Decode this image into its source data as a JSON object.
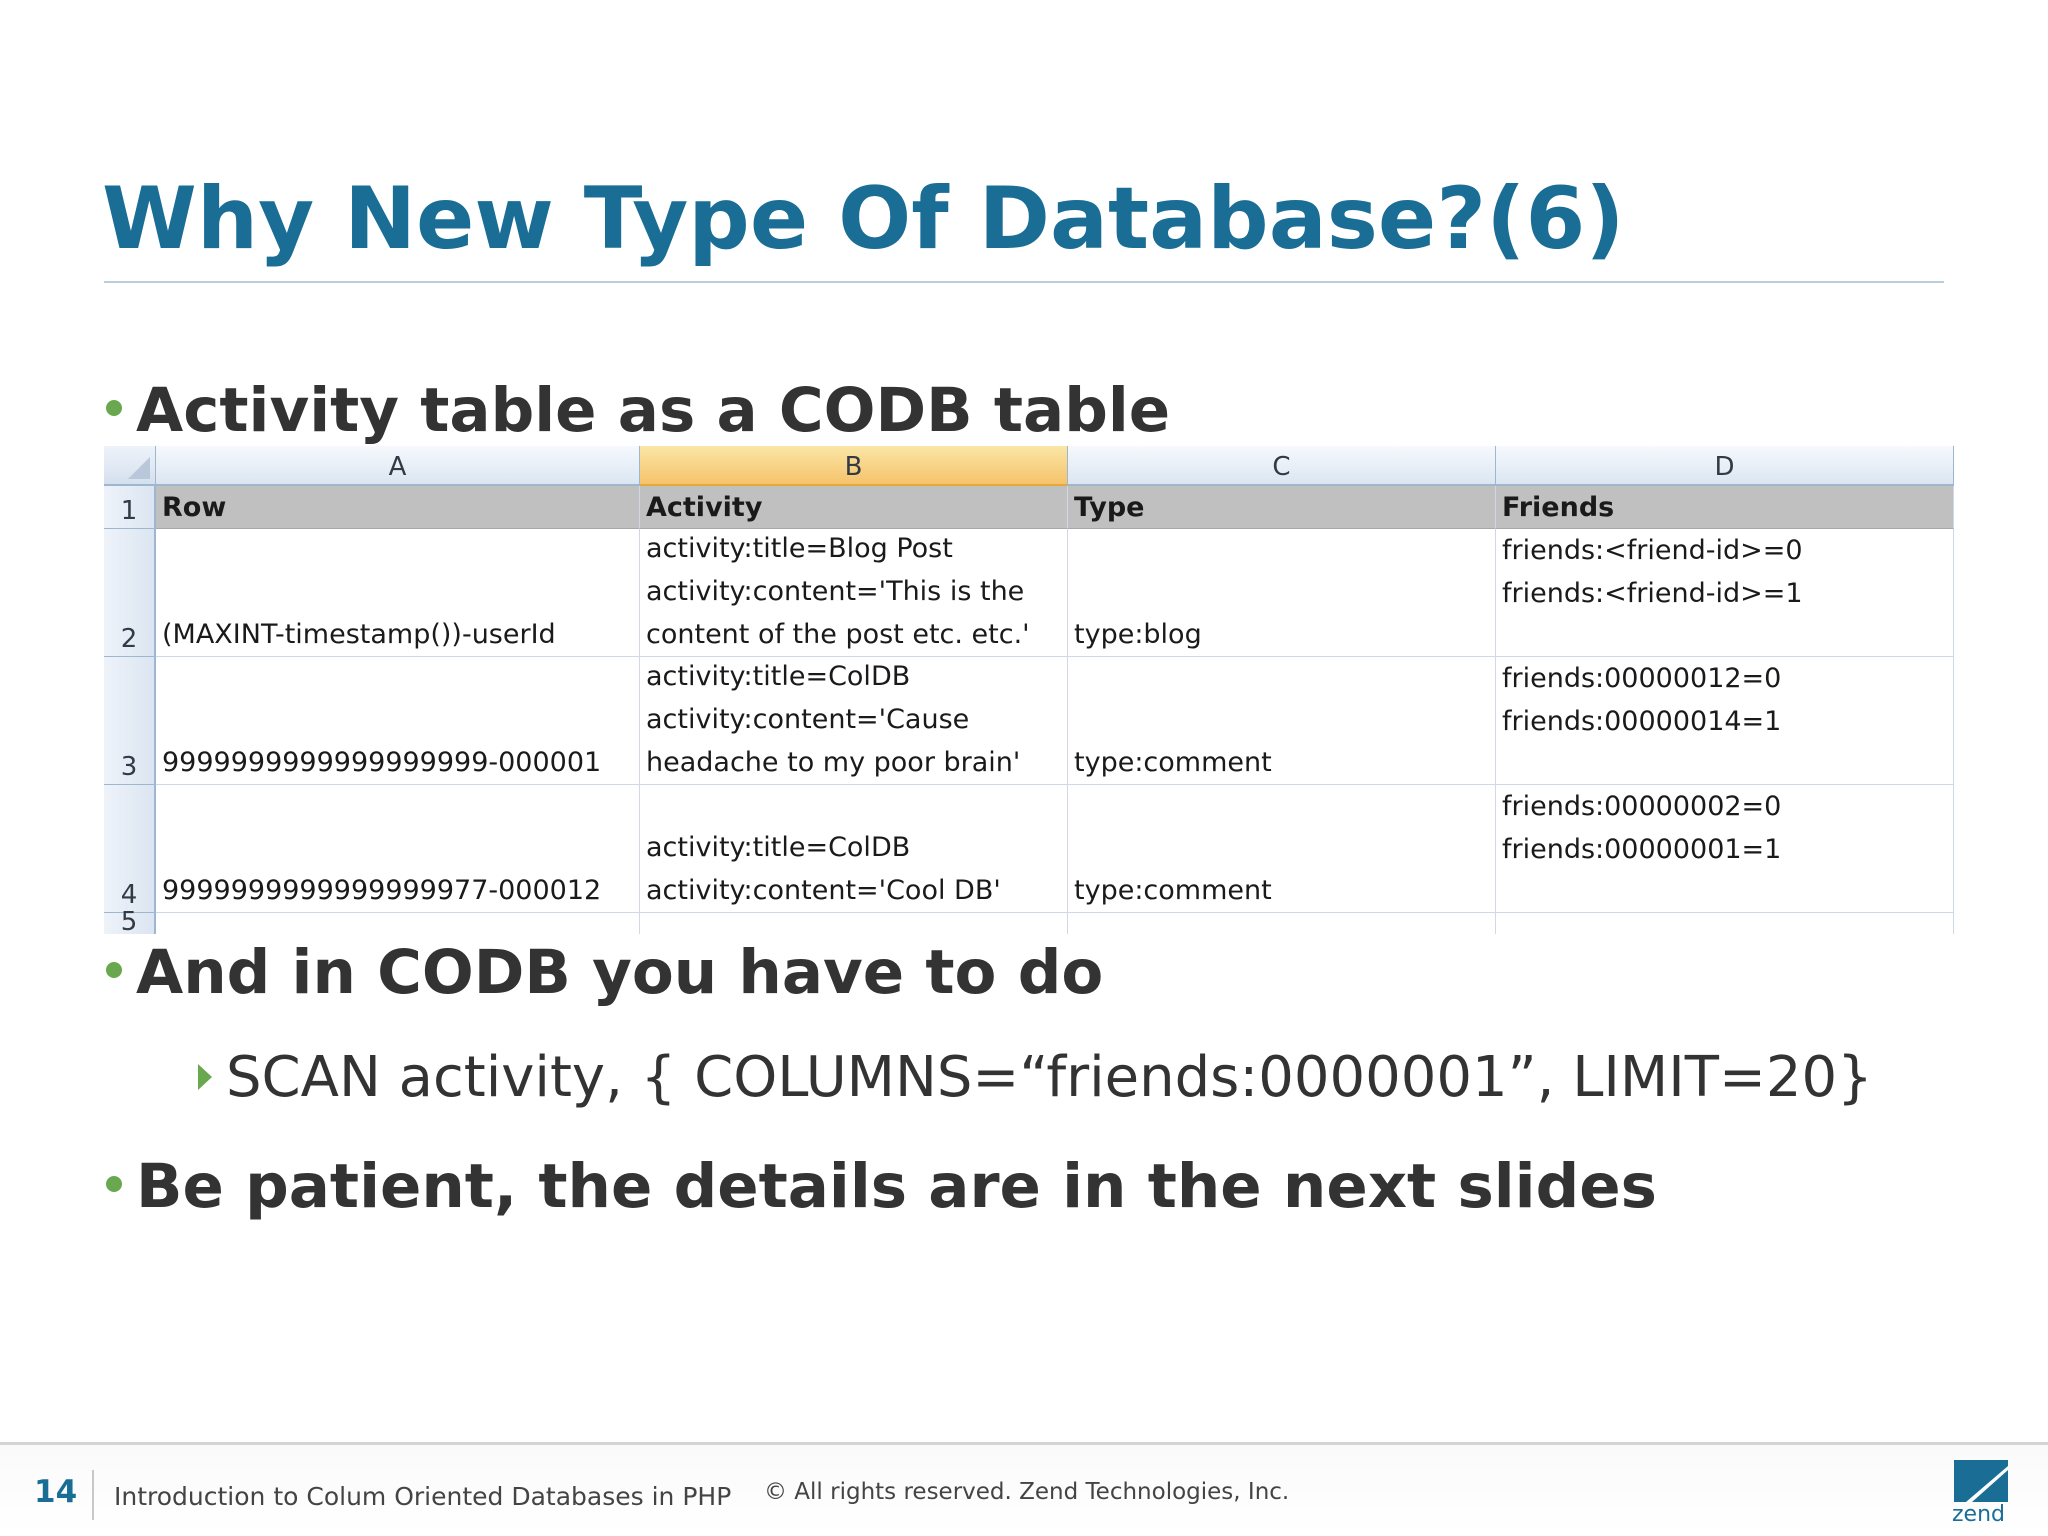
{
  "slide": {
    "title": "Why New Type Of Database?(6)",
    "bullet1": "Activity table as a CODB table",
    "bullet2": "And in CODB you have to do",
    "sub1": "SCAN activity, { COLUMNS=“friends:0000001”, LIMIT=20}",
    "bullet3": "Be patient, the details are in the next slides"
  },
  "sheet": {
    "columns": [
      "A",
      "B",
      "C",
      "D"
    ],
    "selected_column": "B",
    "header_row": {
      "num": "1",
      "cells": [
        "Row",
        "Activity",
        "Type",
        "Friends"
      ]
    },
    "rows": [
      {
        "num": "2",
        "row": "(MAXINT-timestamp())-userId",
        "activity": [
          "activity:title=Blog Post",
          "activity:content='This is the",
          "content of the post etc. etc.'"
        ],
        "type": "type:blog",
        "friends": [
          "friends:<friend-id>=0",
          "friends:<friend-id>=1"
        ]
      },
      {
        "num": "3",
        "row": "9999999999999999999-000001",
        "activity": [
          "activity:title=ColDB",
          "activity:content='Cause",
          "headache to my poor brain'"
        ],
        "type": "type:comment",
        "friends": [
          "friends:00000012=0",
          "friends:00000014=1"
        ]
      },
      {
        "num": "4",
        "row": "9999999999999999977-000012",
        "activity": [
          "activity:title=ColDB",
          "activity:content='Cool DB'"
        ],
        "type": "type:comment",
        "friends": [
          "friends:00000002=0",
          "friends:00000001=1"
        ]
      }
    ],
    "partial_row_num": "5"
  },
  "footer": {
    "page": "14",
    "presentation": "Introduction to Colum Oriented Databases in PHP",
    "copyright": "© All rights reserved. Zend Technologies, Inc.",
    "logo_text": "zend"
  },
  "colors": {
    "title": "#1a6e96",
    "bullet": "#6aa84f",
    "text": "#333333"
  }
}
